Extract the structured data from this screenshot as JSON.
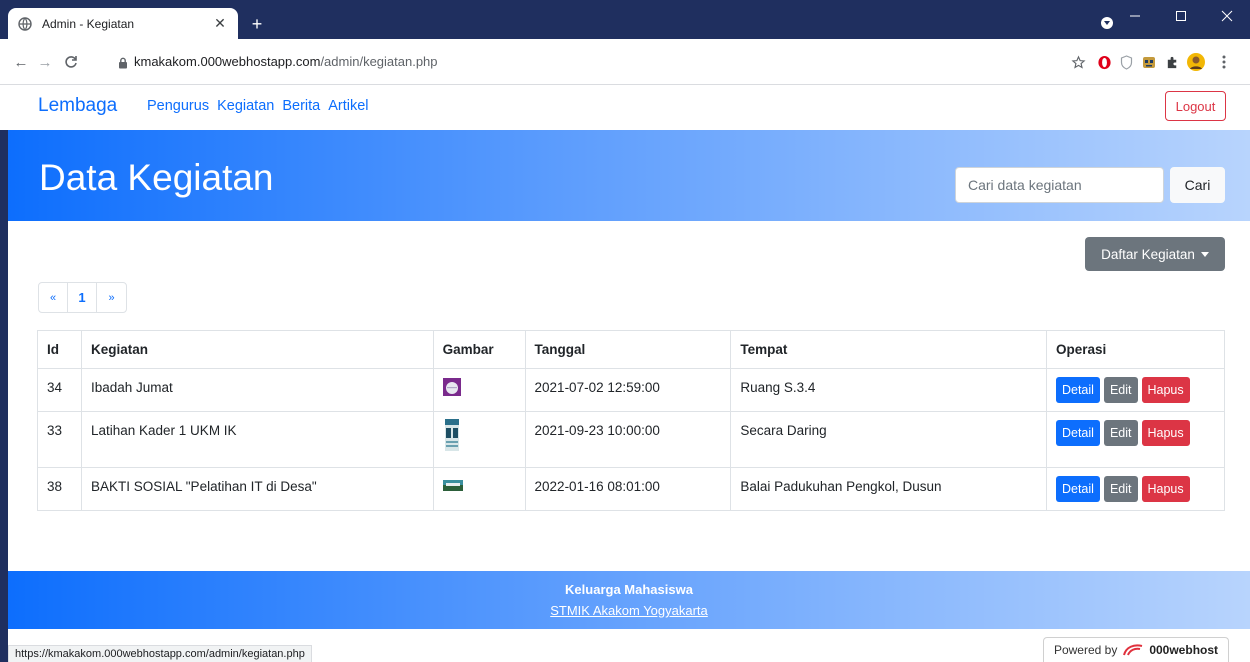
{
  "browser": {
    "tab_title": "Admin - Kegiatan",
    "url_host": "kmakakom.000webhostapp.com",
    "url_path": "/admin/kegiatan.php"
  },
  "nav": {
    "brand": "Lembaga",
    "links": [
      "Pengurus",
      "Kegiatan",
      "Berita",
      "Artikel"
    ],
    "logout": "Logout"
  },
  "hero": {
    "title": "Data Kegiatan",
    "search_placeholder": "Cari data kegiatan",
    "search_button": "Cari"
  },
  "dropdown": {
    "label": "Daftar Kegiatan"
  },
  "pagination": {
    "prev": "«",
    "current": "1",
    "next": "»"
  },
  "table": {
    "headers": [
      "Id",
      "Kegiatan",
      "Gambar",
      "Tanggal",
      "Tempat",
      "Operasi"
    ],
    "rows": [
      {
        "id": "34",
        "kegiatan": "Ibadah Jumat",
        "tanggal": "2021-07-02 12:59:00",
        "tempat": "Ruang S.3.4"
      },
      {
        "id": "33",
        "kegiatan": "Latihan Kader 1 UKM IK",
        "tanggal": "2021-09-23 10:00:00",
        "tempat": "Secara Daring"
      },
      {
        "id": "38",
        "kegiatan": "BAKTI SOSIAL \"Pelatihan IT di Desa\"",
        "tanggal": "2022-01-16 08:01:00",
        "tempat": "Balai Padukuhan Pengkol, Dusun"
      }
    ],
    "ops": {
      "detail": "Detail",
      "edit": "Edit",
      "hapus": "Hapus"
    }
  },
  "footer": {
    "line1": "Keluarga Mahasiswa",
    "line2": "STMIK Akakom Yogyakarta"
  },
  "status_url": "https://kmakakom.000webhostapp.com/admin/kegiatan.php",
  "powered": {
    "prefix": "Powered by",
    "brand": "000webhost"
  },
  "colors": {
    "primary": "#0d6efd",
    "secondary": "#6c757d",
    "danger": "#dc3545",
    "chrome_frame": "#1f2f5f"
  }
}
